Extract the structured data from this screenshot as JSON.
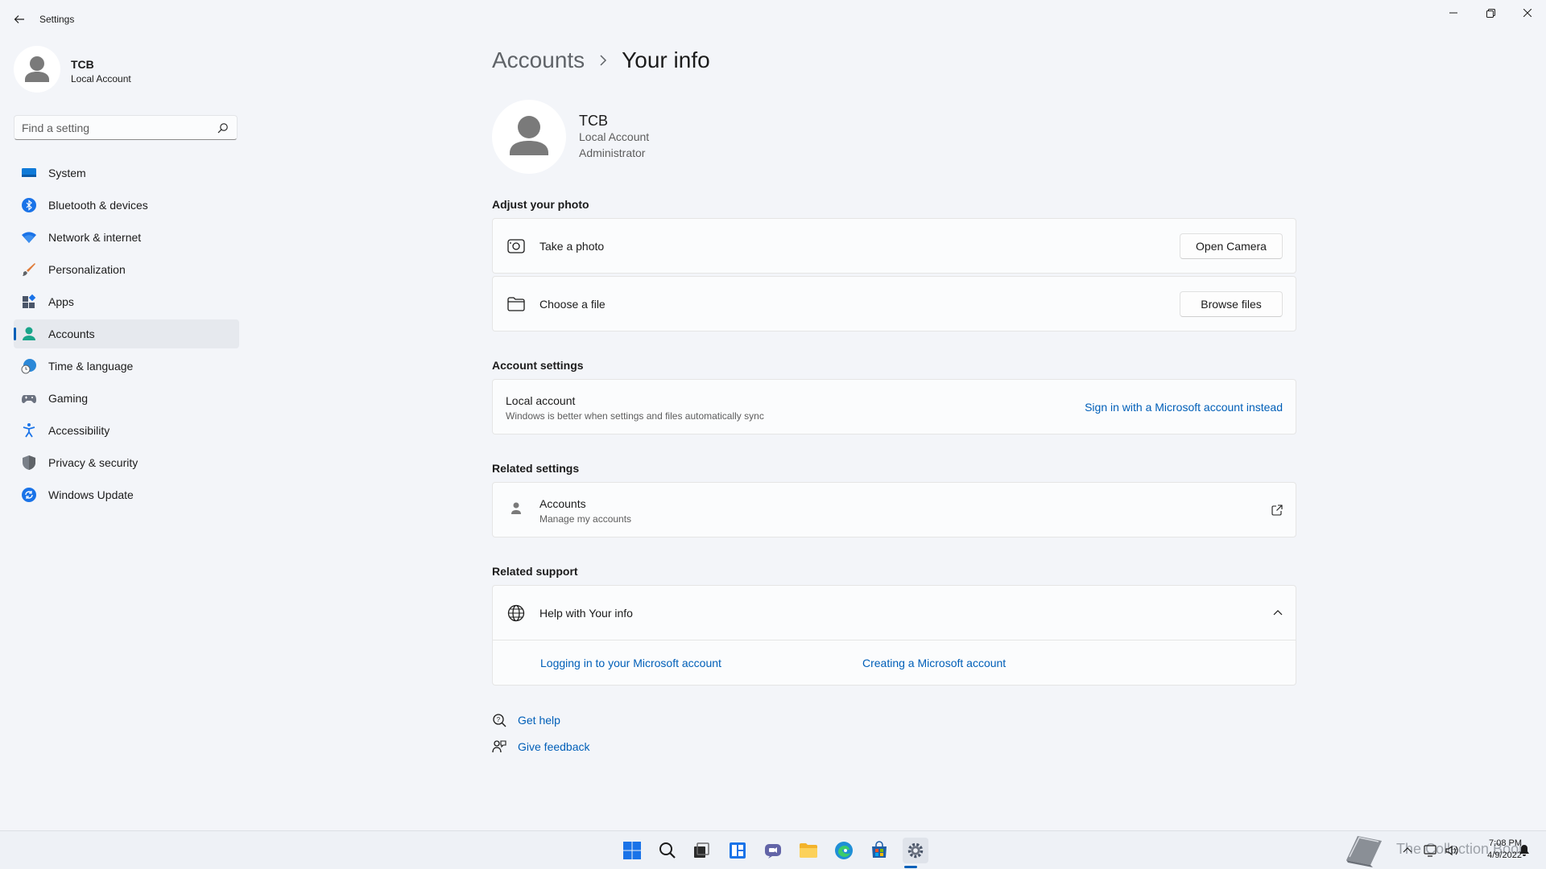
{
  "window": {
    "app_title": "Settings"
  },
  "profile": {
    "name": "TCB",
    "account_type": "Local Account"
  },
  "search": {
    "placeholder": "Find a setting"
  },
  "sidebar": {
    "items": [
      {
        "label": "System",
        "icon": "system-icon",
        "active": false
      },
      {
        "label": "Bluetooth & devices",
        "icon": "bluetooth-icon",
        "active": false
      },
      {
        "label": "Network & internet",
        "icon": "wifi-icon",
        "active": false
      },
      {
        "label": "Personalization",
        "icon": "brush-icon",
        "active": false
      },
      {
        "label": "Apps",
        "icon": "apps-icon",
        "active": false
      },
      {
        "label": "Accounts",
        "icon": "accounts-icon",
        "active": true
      },
      {
        "label": "Time & language",
        "icon": "clock-globe-icon",
        "active": false
      },
      {
        "label": "Gaming",
        "icon": "gamepad-icon",
        "active": false
      },
      {
        "label": "Accessibility",
        "icon": "accessibility-icon",
        "active": false
      },
      {
        "label": "Privacy & security",
        "icon": "shield-icon",
        "active": false
      },
      {
        "label": "Windows Update",
        "icon": "update-icon",
        "active": false
      }
    ]
  },
  "breadcrumb": {
    "parent": "Accounts",
    "current": "Your info"
  },
  "user": {
    "name": "TCB",
    "account_type": "Local Account",
    "role": "Administrator"
  },
  "adjust_photo": {
    "title": "Adjust your photo",
    "take_photo": {
      "label": "Take a photo",
      "button": "Open Camera"
    },
    "choose_file": {
      "label": "Choose a file",
      "button": "Browse files"
    }
  },
  "account_settings": {
    "title": "Account settings",
    "label": "Local account",
    "description": "Windows is better when settings and files automatically sync",
    "link": "Sign in with a Microsoft account instead"
  },
  "related_settings": {
    "title": "Related settings",
    "label": "Accounts",
    "description": "Manage my accounts"
  },
  "related_support": {
    "title": "Related support",
    "label": "Help with Your info",
    "links": [
      "Logging in to your Microsoft account",
      "Creating a Microsoft account"
    ]
  },
  "footer": {
    "get_help": "Get help",
    "give_feedback": "Give feedback"
  },
  "taskbar": {
    "time": "7:08 PM",
    "date": "4/9/2022",
    "watermark": "The Collection Book"
  },
  "colors": {
    "accent": "#005fb8",
    "background": "#f3f5f9",
    "card": "#fbfcfd"
  }
}
